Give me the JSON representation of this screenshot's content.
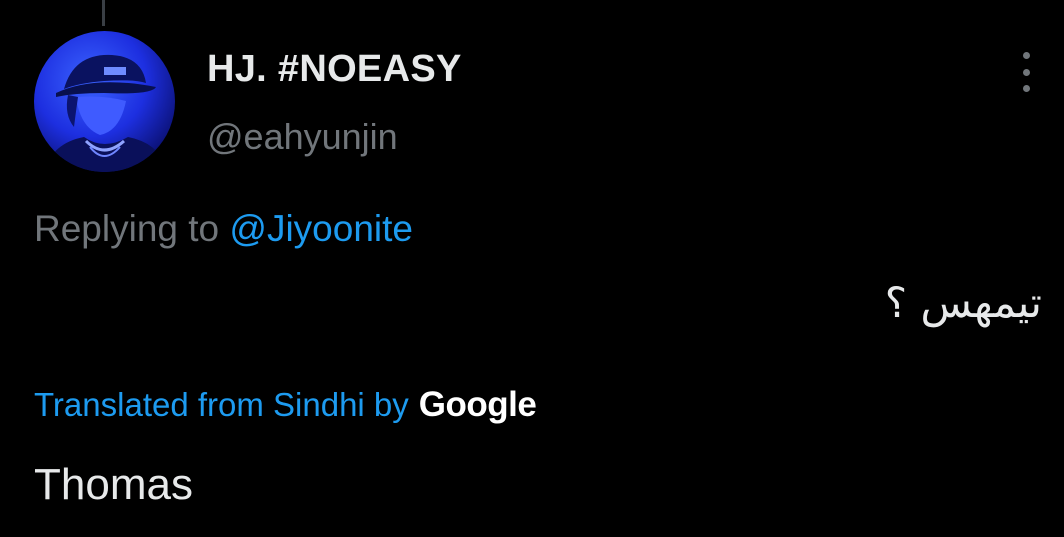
{
  "tweet": {
    "author": {
      "display_name": "HJ. #NOEASY",
      "handle": "@eahyunjin"
    },
    "replying_prefix": "Replying to",
    "replying_to": "@Jiyoonite",
    "text": "تيمهس ؟",
    "translation_label": "Translated from Sindhi by",
    "translation_provider": "Google",
    "translated_text": "Thomas"
  },
  "icons": {
    "more": "more-vertical-icon",
    "avatar": "avatar"
  },
  "colors": {
    "background": "#000000",
    "primary_text": "#e7e9ea",
    "secondary_text": "#71767b",
    "accent": "#1d9bf0"
  }
}
